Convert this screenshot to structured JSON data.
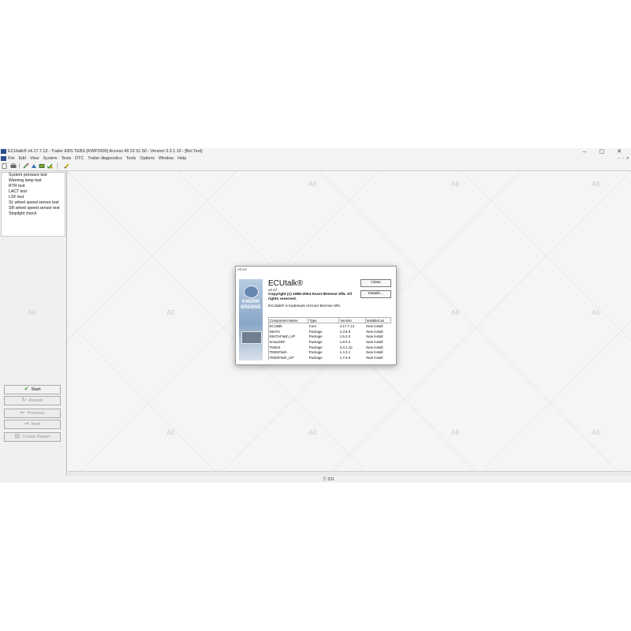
{
  "window": {
    "title": "ECUtalk® v4.17.7.13 - Trailer EBS TEBS (KWP2000) Access 49 22 51 50 - Version 3.3.1.10 - [Bol Test]",
    "controls": [
      "–",
      "▢",
      "✕"
    ]
  },
  "menu": {
    "items": [
      "File",
      "Edit",
      "View",
      "System",
      "Tests",
      "DTC",
      "Trailer diagnostics",
      "Tools",
      "Options",
      "Window",
      "Help"
    ],
    "mdi_controls": [
      "–",
      "▫",
      "✕"
    ]
  },
  "toolbar": {
    "icons": [
      "new-document-icon",
      "printer-icon",
      "probe-icon",
      "gauge-icon",
      "connect-icon",
      "check-icon",
      "pencil-icon"
    ]
  },
  "test_list": {
    "items": [
      "System pressure test",
      "Warning lamp test",
      "RTR test",
      "LACT test",
      "LSF test",
      "SL wheel speed sensor test",
      "SR wheel speed sensor test",
      "Stoplight check"
    ]
  },
  "buttons": {
    "start": "Start",
    "restart": "Restart",
    "previous": "Previous",
    "next": "Next",
    "create_report": "Create Report"
  },
  "watermark": "AE",
  "status": {
    "text": "Ⓣ 231"
  },
  "about": {
    "title": "About",
    "app_name": "ECUtalk®",
    "version": "v4.17",
    "copyright": "Copyright (c) 1999-2004 Knorr-Bremse SfN. All rights reserved.",
    "trademark": "ECUtalk® is trademark of Knorr-Bremse SfN.",
    "brand_line1": "KNORR",
    "brand_line2": "BREMSE",
    "close_label": "Close",
    "details_label": "Details...",
    "columns": [
      "Component Name",
      "Type",
      "Version",
      "Installed as"
    ],
    "components": [
      [
        "ECUtalk",
        "Core",
        "4.17.7.13",
        "New install"
      ],
      [
        "KB4TA",
        "Package",
        "2.3.8.8",
        "New install"
      ],
      [
        "KB4TAFlash_UP",
        "Package",
        "1.6.2.0",
        "New install"
      ],
      [
        "SmaLEBF",
        "Package",
        "1.8.0.2",
        "New install"
      ],
      [
        "TEBS4",
        "Package",
        "3.3.1.10",
        "New install"
      ],
      [
        "TEBSFlash",
        "Package",
        "1.4.3.1",
        "New install"
      ],
      [
        "TEBSFlash_UP",
        "Package",
        "1.7.6.6",
        "New install"
      ]
    ]
  }
}
